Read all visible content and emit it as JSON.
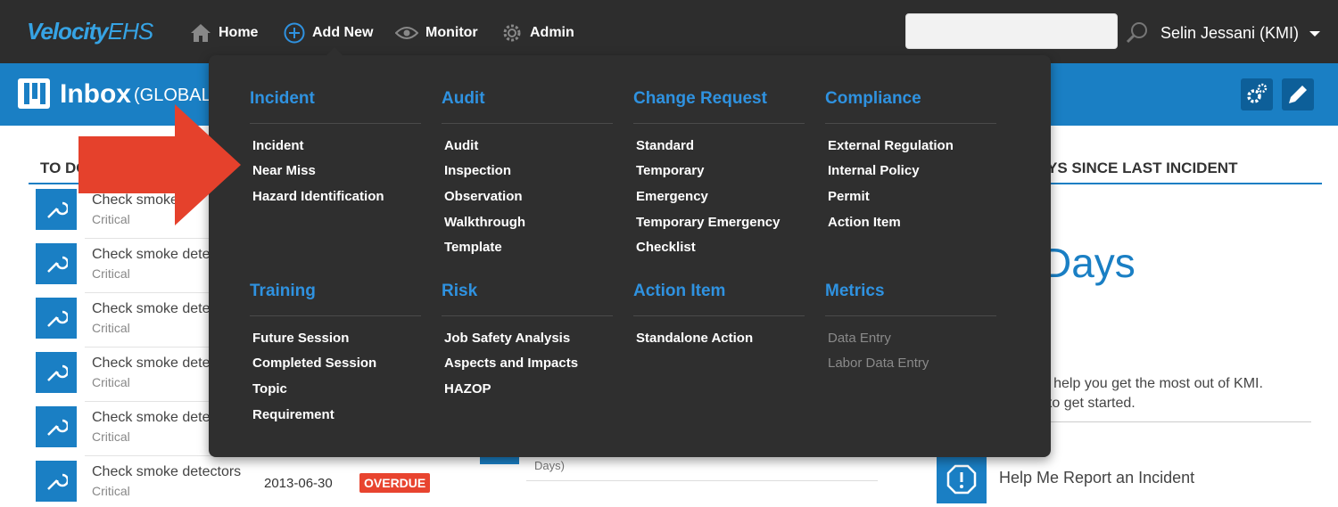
{
  "nav": {
    "logo_main": "Velocity",
    "logo_suffix": "EHS",
    "items": [
      {
        "label": "Home",
        "icon": "home-icon"
      },
      {
        "label": "Add New",
        "icon": "plus-circle-icon"
      },
      {
        "label": "Monitor",
        "icon": "eye-icon"
      },
      {
        "label": "Admin",
        "icon": "gear-icon"
      }
    ],
    "search_placeholder": "",
    "user": "Selin Jessani (KMI)"
  },
  "header": {
    "title": "Inbox",
    "subtitle": "(GLOBAL C"
  },
  "todo": {
    "label": "TO DO",
    "tasks": [
      {
        "name": "Check smoke d",
        "priority": "Critical"
      },
      {
        "name": "Check smoke dete",
        "priority": "Critical"
      },
      {
        "name": "Check smoke dete",
        "priority": "Critical"
      },
      {
        "name": "Check smoke dete",
        "priority": "Critical"
      },
      {
        "name": "Check smoke dete",
        "priority": "Critical"
      },
      {
        "name": "Check smoke detectors",
        "priority": "Critical",
        "due": "2013-06-30",
        "status": "OVERDUE"
      }
    ]
  },
  "middle": {
    "days_text": "Days)"
  },
  "right": {
    "section_label": "YS SINCE LAST INCIDENT",
    "days_word": "Days",
    "help_line1": "e to help you get the most out of KMI.",
    "help_line2": "ow to get started.",
    "help_button": "Help Me Report an Incident"
  },
  "dropdown": {
    "columns": [
      {
        "title": "Incident",
        "items": [
          "Incident",
          "Near Miss",
          "Hazard Identification"
        ]
      },
      {
        "title": "Audit",
        "items": [
          "Audit",
          "Inspection",
          "Observation",
          "Walkthrough",
          "Template"
        ]
      },
      {
        "title": "Change Request",
        "items": [
          "Standard",
          "Temporary",
          "Emergency",
          "Temporary Emergency",
          "Checklist"
        ]
      },
      {
        "title": "Compliance",
        "items": [
          "External Regulation",
          "Internal Policy",
          "Permit",
          "Action Item"
        ]
      },
      {
        "title": "Training",
        "items": [
          "Future Session",
          "Completed Session",
          "Topic",
          "Requirement"
        ]
      },
      {
        "title": "Risk",
        "items": [
          "Job Safety Analysis",
          "Aspects and Impacts",
          "HAZOP"
        ]
      },
      {
        "title": "Action Item",
        "items": [
          "Standalone Action"
        ]
      },
      {
        "title": "Metrics",
        "items": [
          "Data Entry",
          "Labor Data Entry"
        ],
        "disabled": true
      }
    ]
  },
  "colors": {
    "brand_blue": "#1a7fc4",
    "menu_title_blue": "#2f92e0",
    "overdue_red": "#e8442f",
    "arrow_red": "#e5412c"
  }
}
